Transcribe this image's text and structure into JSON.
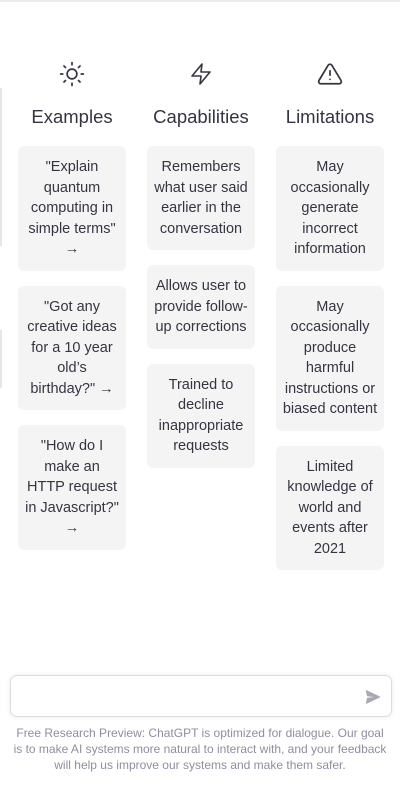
{
  "colors": {
    "text": "#343541",
    "card_bg": "#f4f4f5",
    "footer_text": "#8e8ea0"
  },
  "columns": [
    {
      "icon": "sun-icon",
      "title": "Examples",
      "cards": [
        "\"Explain quantum computing in simple terms\" →",
        "\"Got any creative ideas for a 10 year old’s birthday?\" →",
        "\"How do I make an HTTP request in Javascript?\" →"
      ]
    },
    {
      "icon": "lightning-icon",
      "title": "Capabilities",
      "cards": [
        "Remembers what user said earlier in the conversation",
        "Allows user to provide follow-up corrections",
        "Trained to decline inappropriate requests"
      ]
    },
    {
      "icon": "warning-icon",
      "title": "Limitations",
      "cards": [
        "May occasionally generate incorrect information",
        "May occasionally produce harmful instructions or biased content",
        "Limited knowledge of world and events after 2021"
      ]
    }
  ],
  "composer": {
    "value": "",
    "send_icon": "send-icon"
  },
  "footer": {
    "text": "Free Research Preview: ChatGPT is optimized for dialogue. Our goal is to make AI systems more natural to interact with, and your feedback will help us improve our systems and make them safer."
  }
}
